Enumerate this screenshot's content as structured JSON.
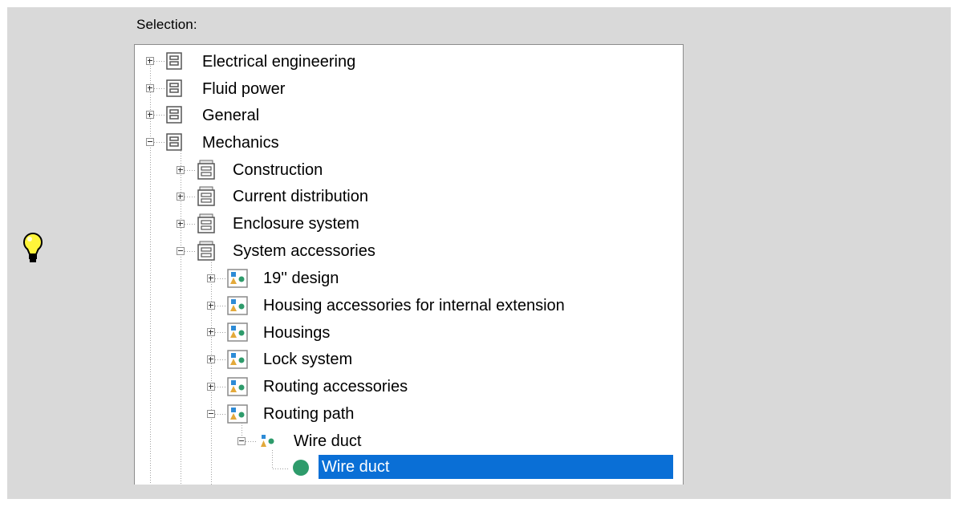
{
  "selection_label": "Selection:",
  "colors": {
    "selection_bg": "#0a6fd6",
    "panel_bg": "#d9d9d9",
    "leaf_dot": "#2e9b6b"
  },
  "tree": {
    "nodes": [
      {
        "label": "Electrical engineering",
        "icon": "database-icon",
        "state": "collapsed",
        "level": 0
      },
      {
        "label": "Fluid power",
        "icon": "database-icon",
        "state": "collapsed",
        "level": 0
      },
      {
        "label": "General",
        "icon": "database-icon",
        "state": "collapsed",
        "level": 0
      },
      {
        "label": "Mechanics",
        "icon": "database-icon",
        "state": "expanded",
        "level": 0
      },
      {
        "label": "Construction",
        "icon": "folder-stack-icon",
        "state": "collapsed",
        "level": 1
      },
      {
        "label": "Current distribution",
        "icon": "folder-stack-icon",
        "state": "collapsed",
        "level": 1
      },
      {
        "label": "Enclosure system",
        "icon": "folder-stack-icon",
        "state": "collapsed",
        "level": 1
      },
      {
        "label": "System accessories",
        "icon": "folder-stack-icon",
        "state": "expanded",
        "level": 1
      },
      {
        "label": "19'' design",
        "icon": "product-group-icon",
        "state": "collapsed",
        "level": 2
      },
      {
        "label": "Housing accessories for internal extension",
        "icon": "product-group-icon",
        "state": "collapsed",
        "level": 2
      },
      {
        "label": "Housings",
        "icon": "product-group-icon",
        "state": "collapsed",
        "level": 2
      },
      {
        "label": "Lock system",
        "icon": "product-group-icon",
        "state": "collapsed",
        "level": 2
      },
      {
        "label": "Routing accessories",
        "icon": "product-group-icon",
        "state": "collapsed",
        "level": 2
      },
      {
        "label": "Routing path",
        "icon": "product-group-icon",
        "state": "expanded",
        "level": 2
      },
      {
        "label": "Wire duct",
        "icon": "product-subgroup-icon",
        "state": "expanded",
        "level": 3
      },
      {
        "label": "Wire duct",
        "icon": "leaf-dot-icon",
        "state": "leaf",
        "level": 4,
        "selected": true
      }
    ]
  }
}
